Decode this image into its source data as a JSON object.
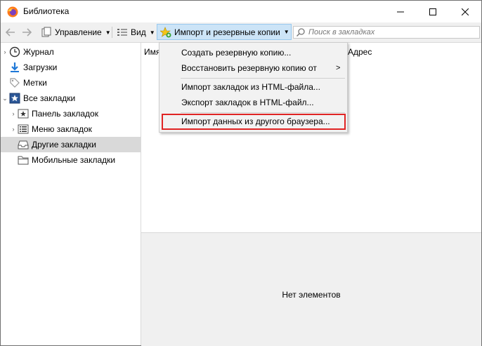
{
  "window": {
    "title": "Библиотека",
    "controls": {
      "minimize": "—",
      "maximize": "☐",
      "close": "✕"
    }
  },
  "toolbar": {
    "back_icon": "arrow-left-icon",
    "forward_icon": "arrow-right-icon",
    "manage_label": "Управление",
    "view_label": "Вид",
    "import_label": "Импорт и резервные копии",
    "search_placeholder": "Поиск в закладках"
  },
  "sidebar": {
    "items": [
      {
        "label": "Журнал",
        "icon": "clock-icon",
        "twisty": "›"
      },
      {
        "label": "Загрузки",
        "icon": "download-icon",
        "twisty": ""
      },
      {
        "label": "Метки",
        "icon": "tag-icon",
        "twisty": ""
      },
      {
        "label": "Все закладки",
        "icon": "star-folder-icon",
        "twisty": "⌄"
      },
      {
        "label": "Панель закладок",
        "icon": "star-box-icon",
        "twisty": "›"
      },
      {
        "label": "Меню закладок",
        "icon": "menu-list-icon",
        "twisty": "›"
      },
      {
        "label": "Другие закладки",
        "icon": "tray-icon",
        "twisty": "",
        "selected": true
      },
      {
        "label": "Мобильные закладки",
        "icon": "folder-icon",
        "twisty": ""
      }
    ]
  },
  "main": {
    "columns": {
      "name": "Имя",
      "address": "Адрес"
    }
  },
  "details": {
    "empty_message": "Нет элементов"
  },
  "import_menu": {
    "items": [
      {
        "label": "Создать резервную копию..."
      },
      {
        "label": "Восстановить резервную копию от",
        "submenu": ">"
      },
      {
        "label": "Импорт закладок из HTML-файла..."
      },
      {
        "label": "Экспорт закладок в HTML-файл..."
      },
      {
        "label": "Импорт данных из другого браузера...",
        "highlighted": true
      }
    ]
  },
  "colors": {
    "highlight_border": "#e02424",
    "button_active_bg": "#cce4f7",
    "selected_row_bg": "#d9d9d9"
  }
}
